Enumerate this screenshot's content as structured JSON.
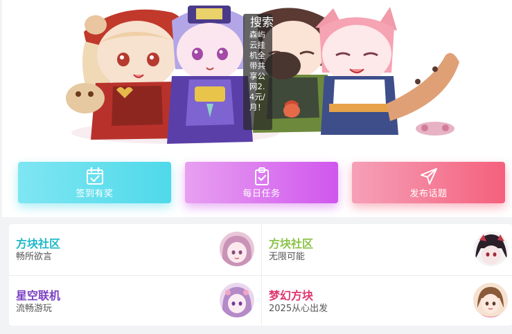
{
  "search": {
    "title": "搜索",
    "text": "森屿云挂机全带共享公网2.4元/月！"
  },
  "actions": [
    {
      "label": "签到有奖",
      "icon": "calendar-check-icon"
    },
    {
      "label": "每日任务",
      "icon": "clipboard-check-icon"
    },
    {
      "label": "发布话题",
      "icon": "paper-plane-icon"
    }
  ],
  "communities": [
    {
      "title": "方块社区",
      "subtitle": "畅所欲言",
      "title_color": "#1fb8c9"
    },
    {
      "title": "方块社区",
      "subtitle": "无限可能",
      "title_color": "#8bc34a"
    },
    {
      "title": "星空联机",
      "subtitle": "流畅游玩",
      "title_color": "#7b3fc4"
    },
    {
      "title": "梦幻方块",
      "subtitle": "2025从心出发",
      "title_color": "#e0356d"
    }
  ]
}
